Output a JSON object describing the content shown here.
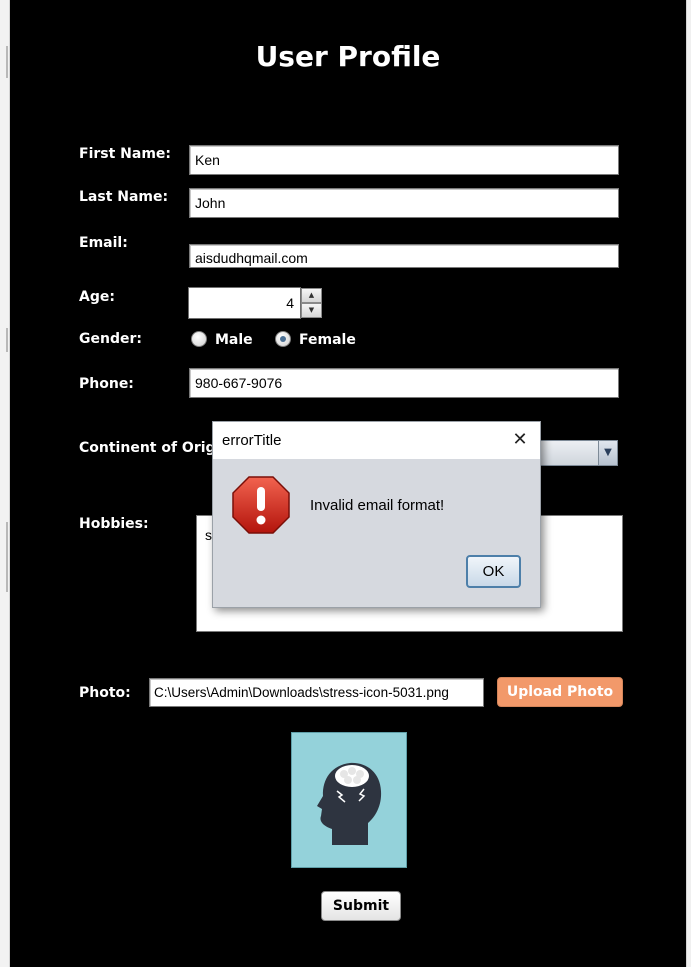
{
  "form": {
    "title": "User Profile",
    "first_name_label": "First Name:",
    "first_name_value": "Ken",
    "last_name_label": "Last Name:",
    "last_name_value": "John",
    "email_label": "Email:",
    "email_value": "aisdudhqmail.com",
    "age_label": "Age:",
    "age_value": "4",
    "gender_label": "Gender:",
    "gender_options": [
      "Male",
      "Female"
    ],
    "gender_selected": "Female",
    "phone_label": "Phone:",
    "phone_value": "980-667-9076",
    "continent_label": "Continent of Origin:",
    "hobbies_label": "Hobbies:",
    "hobbies_value": "s",
    "photo_label": "Photo:",
    "photo_path": "C:\\Users\\Admin\\Downloads\\stress-icon-5031.png",
    "upload_button": "Upload Photo",
    "submit_button": "Submit"
  },
  "dialog": {
    "title": "errorTitle",
    "message": "Invalid email format!",
    "ok_button": "OK",
    "icon": "error-icon"
  },
  "colors": {
    "form_background": "#000000",
    "upload_button": "#f2996a",
    "photo_background": "#94d2da",
    "dialog_background": "#d6d9df"
  }
}
